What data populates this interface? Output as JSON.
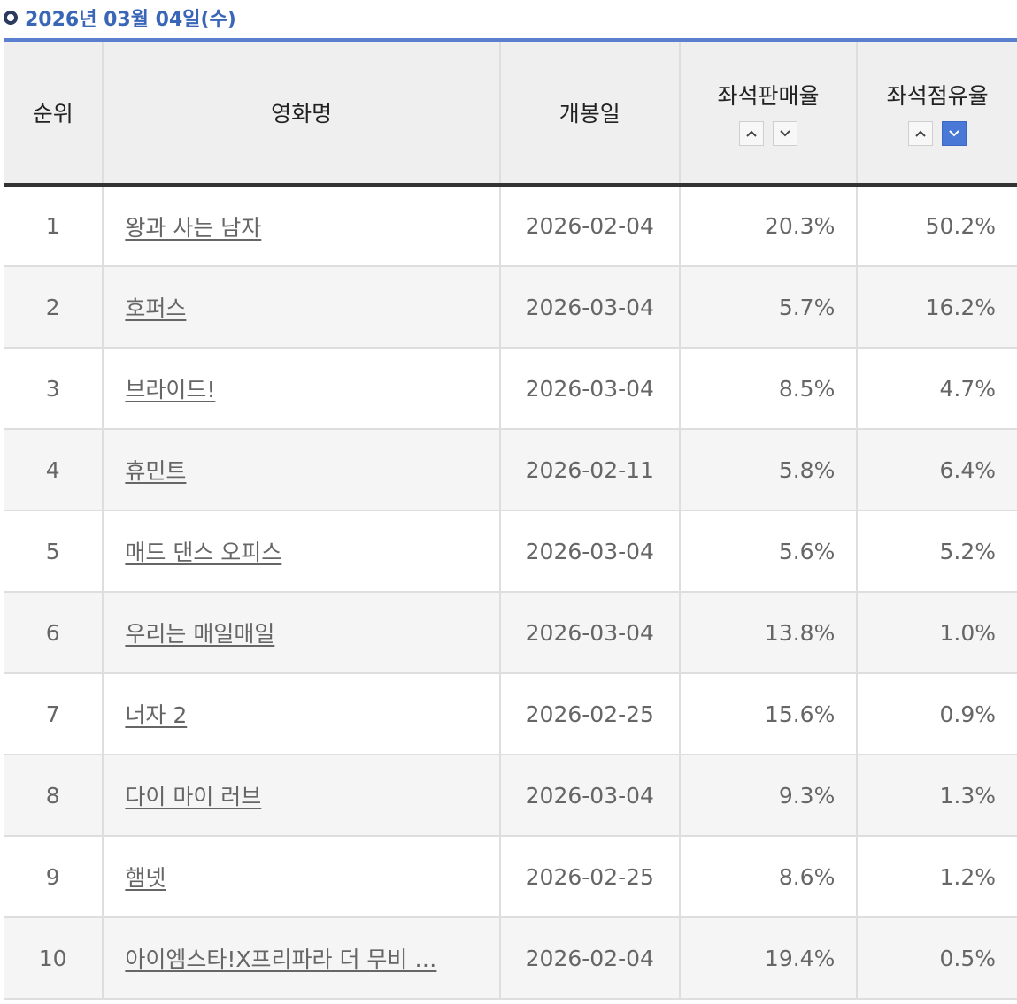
{
  "date_label": "2026년 03월 04일(수)",
  "columns": {
    "rank": "순위",
    "title": "영화명",
    "release": "개봉일",
    "seat_sales": "좌석판매율",
    "seat_share": "좌석점유율"
  },
  "sort": {
    "up_glyph": "⌃",
    "down_glyph": "⌄",
    "active": "seat_share_desc",
    "active_color": "#4a78d6"
  },
  "rows": [
    {
      "rank": "1",
      "title": "왕과 사는 남자",
      "release": "2026-02-04",
      "seat_sales": "20.3%",
      "seat_share": "50.2%"
    },
    {
      "rank": "2",
      "title": "호퍼스",
      "release": "2026-03-04",
      "seat_sales": "5.7%",
      "seat_share": "16.2%"
    },
    {
      "rank": "3",
      "title": "브라이드!",
      "release": "2026-03-04",
      "seat_sales": "8.5%",
      "seat_share": "4.7%"
    },
    {
      "rank": "4",
      "title": "휴민트",
      "release": "2026-02-11",
      "seat_sales": "5.8%",
      "seat_share": "6.4%"
    },
    {
      "rank": "5",
      "title": "매드 댄스 오피스",
      "release": "2026-03-04",
      "seat_sales": "5.6%",
      "seat_share": "5.2%"
    },
    {
      "rank": "6",
      "title": "우리는 매일매일",
      "release": "2026-03-04",
      "seat_sales": "13.8%",
      "seat_share": "1.0%"
    },
    {
      "rank": "7",
      "title": "너자 2",
      "release": "2026-02-25",
      "seat_sales": "15.6%",
      "seat_share": "0.9%"
    },
    {
      "rank": "8",
      "title": "다이 마이 러브",
      "release": "2026-03-04",
      "seat_sales": "9.3%",
      "seat_share": "1.3%"
    },
    {
      "rank": "9",
      "title": "햄넷",
      "release": "2026-02-25",
      "seat_sales": "8.6%",
      "seat_share": "1.2%"
    },
    {
      "rank": "10",
      "title": "아이엠스타!X프리파라 더 무비 …",
      "release": "2026-02-04",
      "seat_sales": "19.4%",
      "seat_share": "0.5%"
    }
  ]
}
